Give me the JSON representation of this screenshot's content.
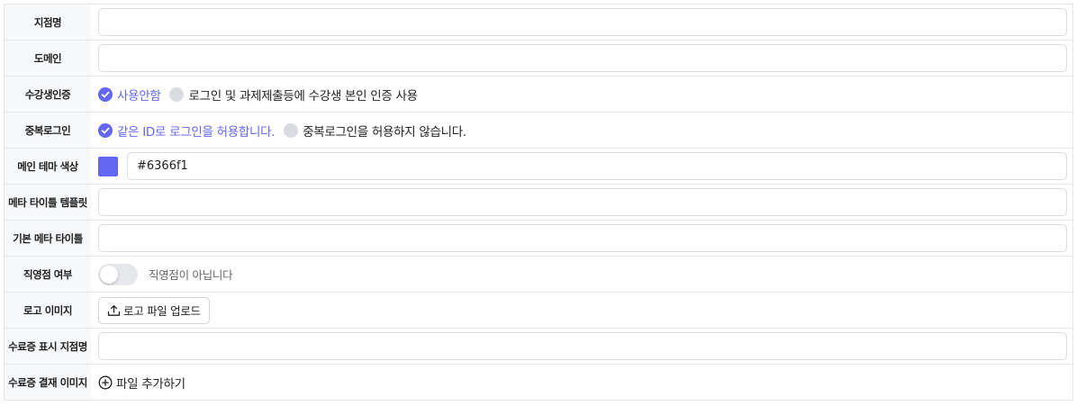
{
  "accent_color": "#6366f1",
  "rows": {
    "branch_name": {
      "label": "지점명",
      "value": ""
    },
    "domain": {
      "label": "도메인",
      "value": ""
    },
    "student_auth": {
      "label": "수강생인증",
      "options": [
        "사용안함",
        "로그인 및 과제제출등에 수강생 본인 인증 사용"
      ],
      "selected": "사용안함"
    },
    "duplicate_login": {
      "label": "중복로그인",
      "options": [
        "같은 ID로 로그인을 허용합니다.",
        "중복로그인을 허용하지 않습니다."
      ],
      "selected": "같은 ID로 로그인을 허용합니다."
    },
    "theme_color": {
      "label": "메인 테마 색상",
      "value": "#6366f1"
    },
    "meta_title_template": {
      "label": "메타 타이틀 템플릿",
      "value": ""
    },
    "default_meta_title": {
      "label": "기본 메타 타이틀",
      "value": ""
    },
    "direct_branch": {
      "label": "직영점 여부",
      "status_text": "직영점이 아닙니다",
      "enabled": false
    },
    "logo_image": {
      "label": "로고 이미지",
      "button_label": "로고 파일 업로드"
    },
    "certificate_branch_name": {
      "label": "수료증 표시 지점명",
      "value": ""
    },
    "certificate_payment_image": {
      "label": "수료증 결재 이미지",
      "button_label": "파일 추가하기"
    }
  }
}
